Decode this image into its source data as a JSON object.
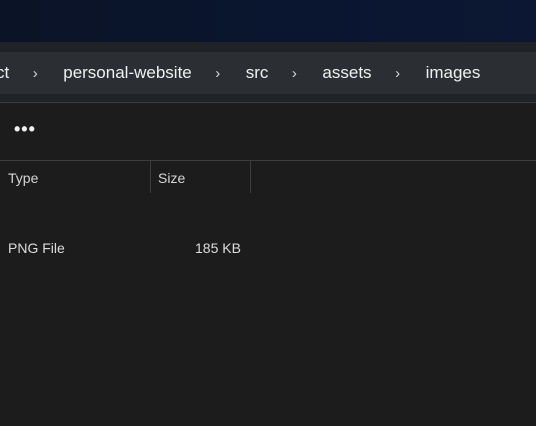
{
  "breadcrumb": {
    "items": [
      "ct",
      "personal-website",
      "src",
      "assets",
      "images"
    ],
    "separator": "›"
  },
  "toolbar": {
    "more_label": "•••"
  },
  "columns": {
    "type": "Type",
    "size": "Size"
  },
  "rows": [
    {
      "type": "PNG File",
      "size": "185 KB"
    }
  ],
  "colors": {
    "titlebar": "#0b1326",
    "addressbar": "#2b2f34",
    "background": "#1c1c1c",
    "text": "#e6e6e6"
  }
}
